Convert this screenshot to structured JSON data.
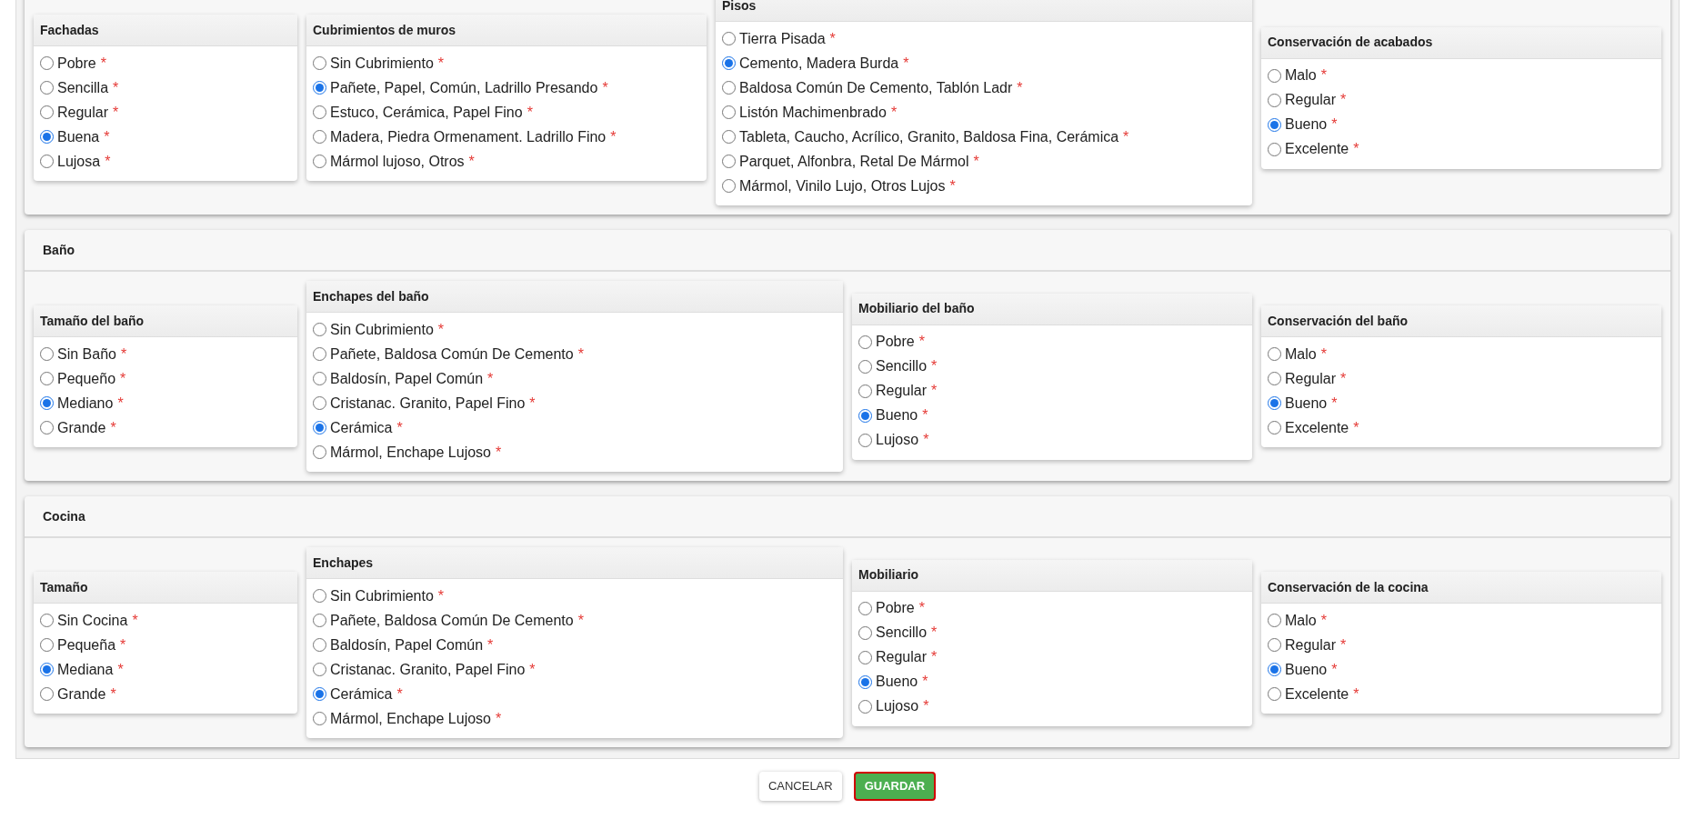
{
  "sections": [
    {
      "groups": [
        {
          "title": "Fachadas",
          "options": [
            {
              "label": "Pobre",
              "mark": "*",
              "selected": false
            },
            {
              "label": "Sencilla",
              "mark": "*",
              "selected": false
            },
            {
              "label": "Regular",
              "mark": "*",
              "selected": false
            },
            {
              "label": "Buena",
              "mark": "*",
              "selected": true
            },
            {
              "label": "Lujosa",
              "mark": "*",
              "selected": false
            }
          ]
        },
        {
          "title": "Cubrimientos de muros",
          "options": [
            {
              "label": "Sin Cubrimiento",
              "mark": "*",
              "selected": false
            },
            {
              "label": "Pañete, Papel, Común, Ladrillo Presando",
              "mark": "*",
              "selected": true
            },
            {
              "label": "Estuco, Cerámica, Papel Fino",
              "mark": "*",
              "selected": false
            },
            {
              "label": "Madera, Piedra Ormenament. Ladrillo Fino",
              "mark": "*",
              "selected": false
            },
            {
              "label": "Mármol lujoso, Otros",
              "mark": "*",
              "selected": false
            }
          ]
        },
        {
          "title": "Pisos",
          "options": [
            {
              "label": "Tierra Pisada",
              "mark": "*",
              "selected": false
            },
            {
              "label": "Cemento, Madera Burda",
              "mark": "*",
              "selected": true
            },
            {
              "label": "Baldosa Común De Cemento, Tablón Ladr",
              "mark": "*",
              "selected": false
            },
            {
              "label": "Listón Machimenbrado",
              "mark": "*",
              "selected": false
            },
            {
              "label": "Tableta, Caucho, Acrílico, Granito, Baldosa Fina, Cerámica",
              "mark": "*",
              "selected": false
            },
            {
              "label": "Parquet, Alfonbra, Retal De Mármol",
              "mark": "*",
              "selected": false
            },
            {
              "label": "Mármol, Vinilo Lujo, Otros Lujos",
              "mark": "*",
              "selected": false
            }
          ]
        },
        {
          "title": "Conservación de acabados",
          "options": [
            {
              "label": "Malo",
              "mark": "*",
              "selected": false
            },
            {
              "label": "Regular",
              "mark": "*",
              "selected": false
            },
            {
              "label": "Bueno",
              "mark": "*",
              "selected": true
            },
            {
              "label": "Excelente",
              "mark": "*",
              "selected": false
            }
          ]
        }
      ]
    },
    {
      "title": "Baño",
      "groups": [
        {
          "title": "Tamaño del baño",
          "options": [
            {
              "label": "Sin Baño",
              "mark": "*",
              "selected": false
            },
            {
              "label": "Pequeño",
              "mark": "*",
              "selected": false
            },
            {
              "label": "Mediano",
              "mark": "*",
              "selected": true
            },
            {
              "label": "Grande",
              "mark": "*",
              "selected": false
            }
          ]
        },
        {
          "title": "Enchapes del baño",
          "options": [
            {
              "label": "Sin Cubrimiento",
              "mark": "*",
              "selected": false
            },
            {
              "label": "Pañete, Baldosa Común De Cemento",
              "mark": "*",
              "selected": false
            },
            {
              "label": "Baldosín, Papel Común",
              "mark": "*",
              "selected": false
            },
            {
              "label": "Cristanac. Granito, Papel Fino",
              "mark": "*",
              "selected": false
            },
            {
              "label": "Cerámica",
              "mark": "*",
              "selected": true
            },
            {
              "label": "Mármol, Enchape Lujoso",
              "mark": "*",
              "selected": false
            }
          ]
        },
        {
          "title": "Mobiliario del baño",
          "options": [
            {
              "label": "Pobre",
              "mark": "*",
              "selected": false
            },
            {
              "label": "Sencillo",
              "mark": "*",
              "selected": false
            },
            {
              "label": "Regular",
              "mark": "*",
              "selected": false
            },
            {
              "label": "Bueno",
              "mark": "*",
              "selected": true
            },
            {
              "label": "Lujoso",
              "mark": "*",
              "selected": false
            }
          ]
        },
        {
          "title": "Conservación del baño",
          "options": [
            {
              "label": "Malo",
              "mark": "*",
              "selected": false
            },
            {
              "label": "Regular",
              "mark": "*",
              "selected": false
            },
            {
              "label": "Bueno",
              "mark": "*",
              "selected": true
            },
            {
              "label": "Excelente",
              "mark": "*",
              "selected": false
            }
          ]
        }
      ]
    },
    {
      "title": "Cocina",
      "groups": [
        {
          "title": "Tamaño",
          "options": [
            {
              "label": "Sin Cocina",
              "mark": "*",
              "selected": false
            },
            {
              "label": "Pequeña",
              "mark": "*",
              "selected": false
            },
            {
              "label": "Mediana",
              "mark": "*",
              "selected": true
            },
            {
              "label": "Grande",
              "mark": "*",
              "selected": false
            }
          ]
        },
        {
          "title": "Enchapes",
          "options": [
            {
              "label": "Sin Cubrimiento",
              "mark": "*",
              "selected": false
            },
            {
              "label": "Pañete, Baldosa Común De Cemento",
              "mark": "*",
              "selected": false
            },
            {
              "label": "Baldosín, Papel Común",
              "mark": "*",
              "selected": false
            },
            {
              "label": "Cristanac. Granito, Papel Fino",
              "mark": "*",
              "selected": false
            },
            {
              "label": "Cerámica",
              "mark": "*",
              "selected": true
            },
            {
              "label": "Mármol, Enchape Lujoso",
              "mark": "*",
              "selected": false
            }
          ]
        },
        {
          "title": "Mobiliario",
          "options": [
            {
              "label": "Pobre",
              "mark": "*",
              "selected": false
            },
            {
              "label": "Sencillo",
              "mark": "*",
              "selected": false
            },
            {
              "label": "Regular",
              "mark": "*",
              "selected": false
            },
            {
              "label": "Bueno",
              "mark": "*",
              "selected": true
            },
            {
              "label": "Lujoso",
              "mark": "*",
              "selected": false
            }
          ]
        },
        {
          "title": "Conservación de la cocina",
          "options": [
            {
              "label": "Malo",
              "mark": "*",
              "selected": false
            },
            {
              "label": "Regular",
              "mark": "*",
              "selected": false
            },
            {
              "label": "Bueno",
              "mark": "*",
              "selected": true
            },
            {
              "label": "Excelente",
              "mark": "*",
              "selected": false
            }
          ]
        }
      ]
    }
  ],
  "buttons": [
    {
      "label": "CANCELAR",
      "kind": "secondary"
    },
    {
      "label": "GUARDAR",
      "kind": "primary"
    }
  ]
}
